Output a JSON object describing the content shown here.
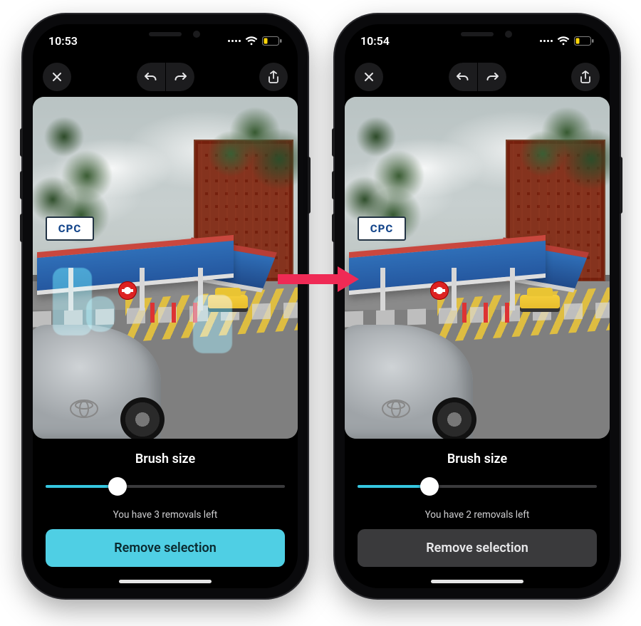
{
  "screens": [
    {
      "status": {
        "time": "10:53"
      },
      "sign_text": "CPC",
      "show_masks": true,
      "panel": {
        "title": "Brush size",
        "slider_percent": 30,
        "hint": "You have 3 removals left",
        "action_label": "Remove selection",
        "action_style": "primary"
      }
    },
    {
      "status": {
        "time": "10:54"
      },
      "sign_text": "CPC",
      "show_masks": false,
      "panel": {
        "title": "Brush size",
        "slider_percent": 30,
        "hint": "You have 2 removals left",
        "action_label": "Remove selection",
        "action_style": "secondary"
      }
    }
  ],
  "colors": {
    "accent": "#4fcfe4",
    "arrow": "#ef2a55"
  }
}
